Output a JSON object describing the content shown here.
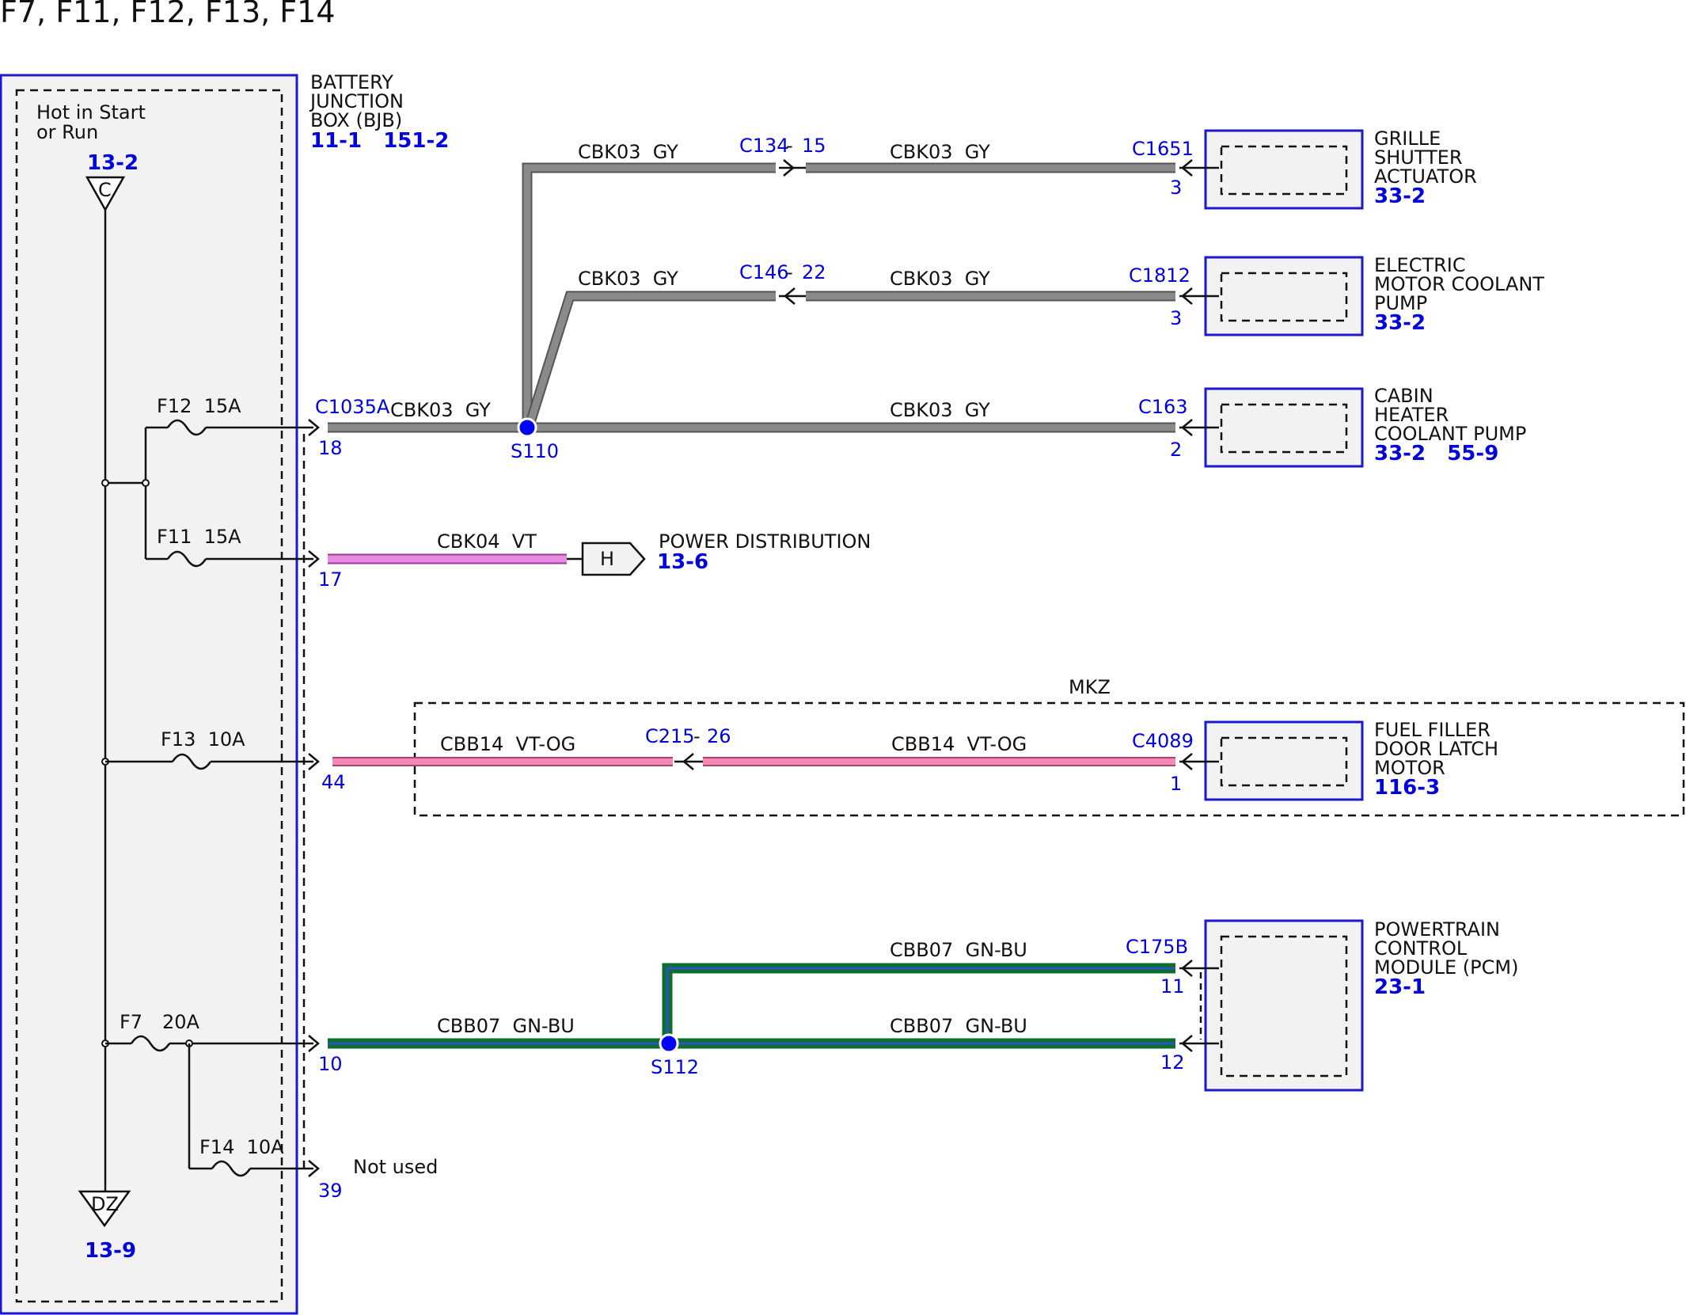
{
  "title": "F7, F11, F12, F13, F14",
  "colors": {
    "gray_wire": "#888888",
    "violet_wire": "#e88ce0",
    "pink_wire": "#f08bb8",
    "green_wire": "#0e6e2c",
    "blue_stripe": "#2a54c8",
    "ref_blue": "#0000dd",
    "splice_blue": "#0000ff"
  },
  "bjb": {
    "name_lines": [
      "BATTERY",
      "JUNCTION",
      "BOX (BJB)"
    ],
    "refs": "11-1   151-2",
    "hot_label_lines": [
      "Hot in Start",
      "or Run"
    ],
    "top_ref": "13-2",
    "top_tag": "C",
    "bottom_tag": "DZ",
    "bottom_ref": "13-9"
  },
  "fuses": {
    "f12": "F12  15A",
    "f11": "F11  15A",
    "f13": "F13  10A",
    "f7_name": "F7",
    "f7_rating": "20A",
    "f14": "F14  10A"
  },
  "bjb_connector": "C1035A",
  "bjb_pins": {
    "p18": "18",
    "p17": "17",
    "p44": "44",
    "p10": "10",
    "p39": "39"
  },
  "wires": {
    "cbk03": "CBK03  GY",
    "cbk04": "CBK04  VT",
    "cbb14": "CBB14  VT-OG",
    "cbb07": "CBB07  GN-BU"
  },
  "splices": {
    "s110": "S110",
    "s112": "S112"
  },
  "inline_connectors": {
    "c134_name": "C134",
    "c134_dash": "-",
    "c134_pin": "15",
    "c146_name": "C146",
    "c146_dash": "-",
    "c146_pin": "22",
    "c215_name": "C215",
    "c215_dash": "-",
    "c215_pin": "26"
  },
  "components": {
    "grille": {
      "connector": "C1651",
      "pin": "3",
      "name_lines": [
        "GRILLE",
        "SHUTTER",
        "ACTUATOR"
      ],
      "refs": "33-2"
    },
    "emcp": {
      "connector": "C1812",
      "pin": "3",
      "name_lines": [
        "ELECTRIC",
        "MOTOR COOLANT",
        "PUMP"
      ],
      "refs": "33-2"
    },
    "cabin": {
      "connector": "C163",
      "pin": "2",
      "name_lines": [
        "CABIN",
        "HEATER",
        "COOLANT PUMP"
      ],
      "refs": "33-2   55-9"
    },
    "fuel": {
      "connector": "C4089",
      "pin": "1",
      "name_lines": [
        "FUEL FILLER",
        "DOOR LATCH",
        "MOTOR"
      ],
      "refs": "116-3"
    },
    "pcm": {
      "connector": "C175B",
      "pin_a": "11",
      "pin_b": "12",
      "name_lines": [
        "POWERTRAIN",
        "CONTROL",
        "MODULE (PCM)"
      ],
      "refs": "23-1"
    }
  },
  "power_distribution": {
    "tag": "H",
    "label": "POWER DISTRIBUTION",
    "ref": "13-6"
  },
  "mkz_label": "MKZ",
  "not_used": "Not used"
}
